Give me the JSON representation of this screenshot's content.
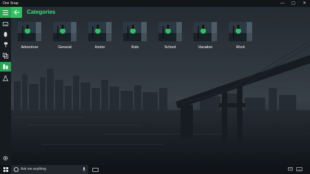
{
  "window": {
    "app_title": "One Snap",
    "minimize_glyph": "—",
    "maximize_glyph": "▢",
    "close_glyph": "✕"
  },
  "header": {
    "title": "Categories",
    "accent_color": "#2aa452",
    "title_color": "#3ee27d"
  },
  "sidebar": {
    "items": [
      {
        "icon": "keyboard-icon"
      },
      {
        "icon": "mouse-icon"
      },
      {
        "icon": "pin-icon"
      },
      {
        "icon": "copy-icon"
      },
      {
        "icon": "categories-icon",
        "active": true
      },
      {
        "icon": "flask-icon"
      }
    ],
    "bottom_icon": "settings-icon"
  },
  "categories": [
    {
      "label": "Adventure"
    },
    {
      "label": "General"
    },
    {
      "label": "Home"
    },
    {
      "label": "Kids"
    },
    {
      "label": "School"
    },
    {
      "label": "Vacation"
    },
    {
      "label": "Work"
    }
  ],
  "taskbar": {
    "search_placeholder": "Ask me anything"
  }
}
